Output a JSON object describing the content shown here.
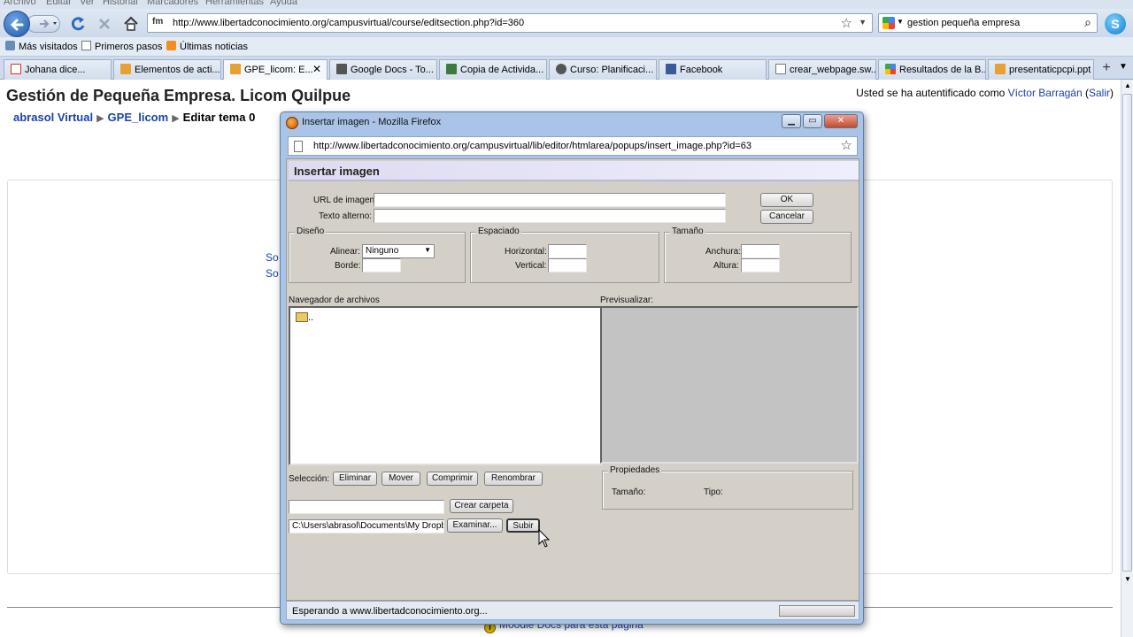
{
  "browser": {
    "menu": [
      "Archivo",
      "Editar",
      "Ver",
      "Historial",
      "Marcadores",
      "Herramientas",
      "Ayuda"
    ],
    "url": "http://www.libertadconocimiento.org/campusvirtual/course/editsection.php?id=360",
    "search_value": "gestion pequeña empresa",
    "bookmarks": [
      "Más visitados",
      "Primeros pasos",
      "Últimas noticias"
    ],
    "tabs": [
      {
        "label": "Johana dice...",
        "icon_color": "#d93025"
      },
      {
        "label": "Elementos de acti...",
        "icon_color": "#e8a030"
      },
      {
        "label": "GPE_licom: E...",
        "icon_color": "#e8a030",
        "close": "✕"
      },
      {
        "label": "Google Docs - To...",
        "icon_color": "#555555"
      },
      {
        "label": "Copia de Activida...",
        "icon_color": "#3d7a3d"
      },
      {
        "label": "Curso: Planificaci...",
        "icon_color": "#555555"
      },
      {
        "label": "Facebook",
        "icon_color": "#3b5998"
      },
      {
        "label": "crear_webpage.sw...",
        "icon_color": "#ffffff"
      },
      {
        "label": "Resultados de la B...",
        "icon_color": "#4285f4"
      },
      {
        "label": "presentaticpcpi.ppt",
        "icon_color": "#e8a030"
      }
    ],
    "new_tab": "+"
  },
  "page": {
    "title": "Gestión de Pequeña Empresa. Licom Quilpue",
    "login_prefix": "Usted se ha autentificado como",
    "login_user": "Víctor Barragán",
    "logout": "Salir",
    "breadcrumb": [
      "abrasol Virtual",
      "GPE_licom",
      "Editar tema 0"
    ],
    "stub_links": [
      "So",
      "So"
    ],
    "footer_link": "Moodle Docs para esta página"
  },
  "popup": {
    "window_title": "Insertar imagen - Mozilla Firefox",
    "url": "http://www.libertadconocimiento.org/campusvirtual/lib/editor/htmlarea/popups/insert_image.php?id=63",
    "heading": "Insertar imagen",
    "image_url_label": "URL de imagen:",
    "image_url_value": "",
    "alt_text_label": "Texto alterno:",
    "alt_text_value": "",
    "ok_label": "OK",
    "cancel_label": "Cancelar",
    "layout": {
      "legend": "Diseño",
      "align_label": "Alinear:",
      "align_value": "Ninguno",
      "border_label": "Borde:"
    },
    "spacing": {
      "legend": "Espaciado",
      "horizontal_label": "Horizontal:",
      "vertical_label": "Vertical:"
    },
    "size": {
      "legend": "Tamaño",
      "width_label": "Anchura:",
      "height_label": "Altura:"
    },
    "file_browser_label": "Navegador de archivos",
    "parent_folder": "..",
    "preview_label": "Previsualizar:",
    "selection_label": "Selección:",
    "delete_label": "Eliminar",
    "move_label": "Mover",
    "zip_label": "Comprimir",
    "rename_label": "Renombrar",
    "properties": {
      "legend": "Propiedades",
      "size_label": "Tamaño:",
      "type_label": "Tipo:"
    },
    "new_folder_value": "",
    "create_folder_label": "Crear carpeta",
    "upload_path": "C:\\Users\\abrasol\\Documents\\My Dropbox",
    "browse_label": "Examinar...",
    "upload_label": "Subir",
    "status": "Esperando a www.libertadconocimiento.org..."
  }
}
